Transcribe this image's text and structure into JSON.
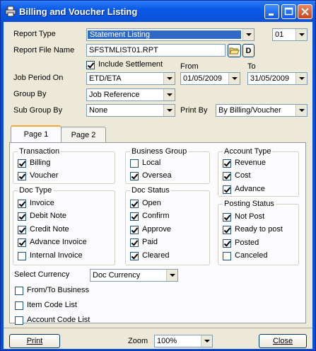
{
  "window": {
    "title": "Billing and Voucher Listing"
  },
  "form": {
    "report_type_label": "Report Type",
    "report_type_value": "Statement Listing",
    "report_number_value": "01",
    "report_file_label": "Report File Name",
    "report_file_value": "SFSTMLIST01.RPT",
    "d_button": "D",
    "include_settlement_label": "Include Settlement",
    "from_label": "From",
    "to_label": "To",
    "job_period_label": "Job Period On",
    "job_period_value": "ETD/ETA",
    "from_date": "01/05/2009",
    "to_date": "31/05/2009",
    "group_by_label": "Group By",
    "group_by_value": "Job Reference",
    "sub_group_label": "Sub Group By",
    "sub_group_value": "None",
    "print_by_label": "Print By",
    "print_by_value": "By Billing/Voucher"
  },
  "tabs": [
    {
      "label": "Page 1"
    },
    {
      "label": "Page 2"
    }
  ],
  "groups": {
    "transaction": {
      "title": "Transaction",
      "items": [
        {
          "label": "Billing",
          "checked": true
        },
        {
          "label": "Voucher",
          "checked": true
        }
      ]
    },
    "business_group": {
      "title": "Business Group",
      "items": [
        {
          "label": "Local",
          "checked": false
        },
        {
          "label": "Oversea",
          "checked": true
        }
      ]
    },
    "account_type": {
      "title": "Account Type",
      "items": [
        {
          "label": "Revenue",
          "checked": true
        },
        {
          "label": "Cost",
          "checked": true
        },
        {
          "label": "Advance",
          "checked": true
        }
      ]
    },
    "doc_type": {
      "title": "Doc Type",
      "items": [
        {
          "label": "Invoice",
          "checked": true
        },
        {
          "label": "Debit Note",
          "checked": true
        },
        {
          "label": "Credit Note",
          "checked": true
        },
        {
          "label": "Advance Invoice",
          "checked": true
        },
        {
          "label": "Internal Invoice",
          "checked": false
        }
      ]
    },
    "doc_status": {
      "title": "Doc Status",
      "items": [
        {
          "label": "Open",
          "checked": true
        },
        {
          "label": "Confirm",
          "checked": true
        },
        {
          "label": "Approve",
          "checked": true
        },
        {
          "label": "Paid",
          "checked": true
        },
        {
          "label": "Cleared",
          "checked": true
        }
      ]
    },
    "posting_status": {
      "title": "Posting Status",
      "items": [
        {
          "label": "Not Post",
          "checked": true
        },
        {
          "label": "Ready to post",
          "checked": true
        },
        {
          "label": "Posted",
          "checked": true
        },
        {
          "label": "Canceled",
          "checked": false
        }
      ]
    }
  },
  "currency": {
    "label": "Select Currency",
    "value": "Doc Currency"
  },
  "options": [
    {
      "label": "From/To Business",
      "checked": false
    },
    {
      "label": "Item Code List",
      "checked": false
    },
    {
      "label": "Account Code List",
      "checked": false
    }
  ],
  "footer": {
    "print_button": "Print",
    "zoom_label": "Zoom",
    "zoom_value": "100%",
    "close_button": "Close"
  }
}
